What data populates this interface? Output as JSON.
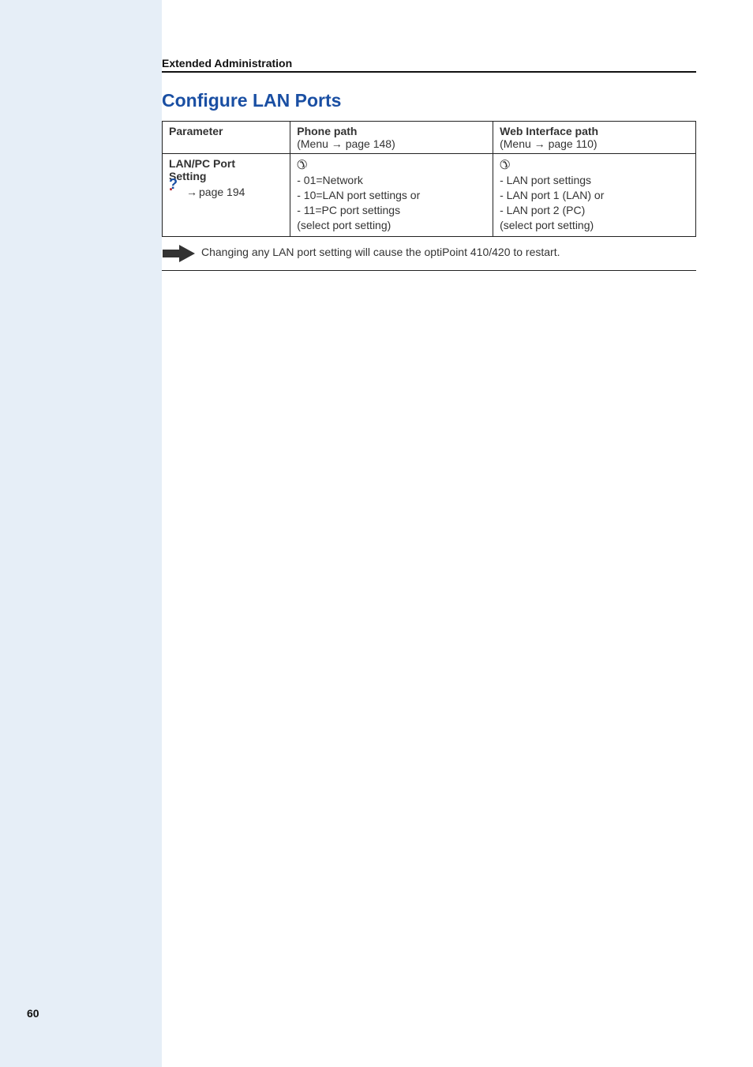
{
  "running_head": "Extended Administration",
  "section_title": "Configure LAN Ports",
  "page_number": "60",
  "table": {
    "headers": {
      "parameter": "Parameter",
      "phone_path": "Phone path",
      "phone_sub": "(Menu → page 148)",
      "web_path": "Web Interface path",
      "web_sub": "(Menu → page 110)"
    },
    "row": {
      "param_name1": "LAN/PC Port",
      "param_name2": "Setting",
      "help_arrow": "→",
      "help_page": "page 194",
      "phone_lines": [
        "- 01=Network",
        "- 10=LAN port settings or",
        "- 11=PC port settings",
        "(select port setting)"
      ],
      "web_lines": [
        "- LAN port settings",
        "- LAN port 1 (LAN) or",
        "- LAN port 2 (PC)",
        "(select port setting)"
      ]
    }
  },
  "note": "Changing any LAN port setting will cause the optiPoint 410/420 to restart."
}
